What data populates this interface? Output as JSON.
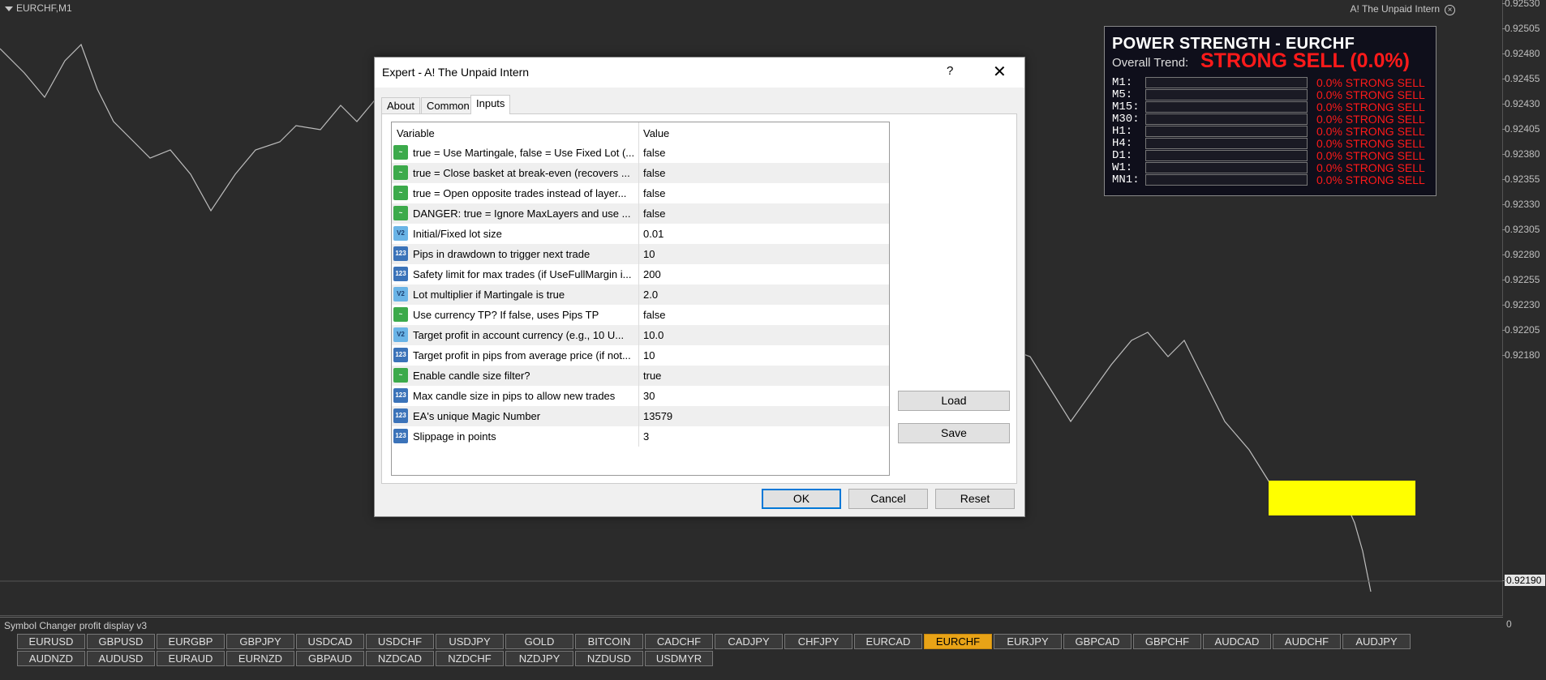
{
  "chart": {
    "title": "EURCHF,M1",
    "ea_name": "A! The Unpaid Intern",
    "close_icon": "close-circle-icon",
    "price_ticks": [
      "0.92530",
      "0.92505",
      "0.92480",
      "0.92455",
      "0.92430",
      "0.92405",
      "0.92380",
      "0.92355",
      "0.92330",
      "0.92305",
      "0.92280",
      "0.92255",
      "0.92230",
      "0.92205",
      "0.92180"
    ],
    "current_price": "0.92190",
    "subwindow_zero": "0"
  },
  "power": {
    "title": "POWER STRENGTH - EURCHF",
    "overall_label": "Overall Trend:",
    "overall_value": "STRONG SELL (0.0%)",
    "timeframes": [
      {
        "label": "M1:",
        "value": "0.0% STRONG SELL"
      },
      {
        "label": "M5:",
        "value": "0.0% STRONG SELL"
      },
      {
        "label": "M15:",
        "value": "0.0% STRONG SELL"
      },
      {
        "label": "M30:",
        "value": "0.0% STRONG SELL"
      },
      {
        "label": "H1:",
        "value": "0.0% STRONG SELL"
      },
      {
        "label": "H4:",
        "value": "0.0% STRONG SELL"
      },
      {
        "label": "D1:",
        "value": "0.0% STRONG SELL"
      },
      {
        "label": "W1:",
        "value": "0.0% STRONG SELL"
      },
      {
        "label": "MN1:",
        "value": "0.0% STRONG SELL"
      }
    ],
    "sell_color": "#ff1a1a"
  },
  "dialog": {
    "title": "Expert - A! The Unpaid Intern",
    "help": "?",
    "tabs": [
      "About",
      "Common",
      "Inputs"
    ],
    "active_tab": "Inputs",
    "headers": {
      "variable": "Variable",
      "value": "Value"
    },
    "rows": [
      {
        "icon": "bool",
        "variable": "true = Use Martingale, false = Use Fixed Lot (...",
        "value": "false"
      },
      {
        "icon": "bool",
        "variable": "true = Close basket at break-even (recovers ...",
        "value": "false"
      },
      {
        "icon": "bool",
        "variable": "true = Open opposite trades instead of layer...",
        "value": "false"
      },
      {
        "icon": "bool",
        "variable": "DANGER: true = Ignore MaxLayers and use ...",
        "value": "false"
      },
      {
        "icon": "dbl",
        "variable": "Initial/Fixed lot size",
        "value": "0.01"
      },
      {
        "icon": "int",
        "variable": "Pips in drawdown to trigger next trade",
        "value": "10"
      },
      {
        "icon": "int",
        "variable": "Safety limit for max trades (if UseFullMargin i...",
        "value": "200"
      },
      {
        "icon": "dbl",
        "variable": "Lot multiplier if Martingale is true",
        "value": "2.0"
      },
      {
        "icon": "bool",
        "variable": "Use currency TP? If false, uses Pips TP",
        "value": "false"
      },
      {
        "icon": "dbl",
        "variable": "Target profit in account currency (e.g., 10 U...",
        "value": "10.0"
      },
      {
        "icon": "int",
        "variable": "Target profit in pips from average price (if not...",
        "value": "10"
      },
      {
        "icon": "bool",
        "variable": "Enable candle size filter?",
        "value": "true"
      },
      {
        "icon": "int",
        "variable": "Max candle size in pips to allow new trades",
        "value": "30"
      },
      {
        "icon": "int",
        "variable": "EA's unique Magic Number",
        "value": "13579"
      },
      {
        "icon": "int",
        "variable": "Slippage in points",
        "value": "3"
      }
    ],
    "icon_glyphs": {
      "bool": "~",
      "int": "123",
      "dbl": "V2"
    },
    "buttons": {
      "load": "Load",
      "save": "Save",
      "ok": "OK",
      "cancel": "Cancel",
      "reset": "Reset"
    }
  },
  "symbols": {
    "panel_label": "Symbol Changer profit display v3",
    "active": "EURCHF",
    "active_color": "#e8a317",
    "row1": [
      "EURUSD",
      "GBPUSD",
      "EURGBP",
      "GBPJPY",
      "USDCAD",
      "USDCHF",
      "USDJPY",
      "GOLD",
      "BITCOIN",
      "CADCHF",
      "CADJPY",
      "CHFJPY",
      "EURCAD",
      "EURCHF",
      "EURJPY",
      "GBPCAD",
      "GBPCHF",
      "AUDCAD",
      "AUDCHF",
      "AUDJPY"
    ],
    "row2": [
      "AUDNZD",
      "AUDUSD",
      "EURAUD",
      "EURNZD",
      "GBPAUD",
      "NZDCAD",
      "NZDCHF",
      "NZDJPY",
      "NZDUSD",
      "USDMYR"
    ]
  }
}
